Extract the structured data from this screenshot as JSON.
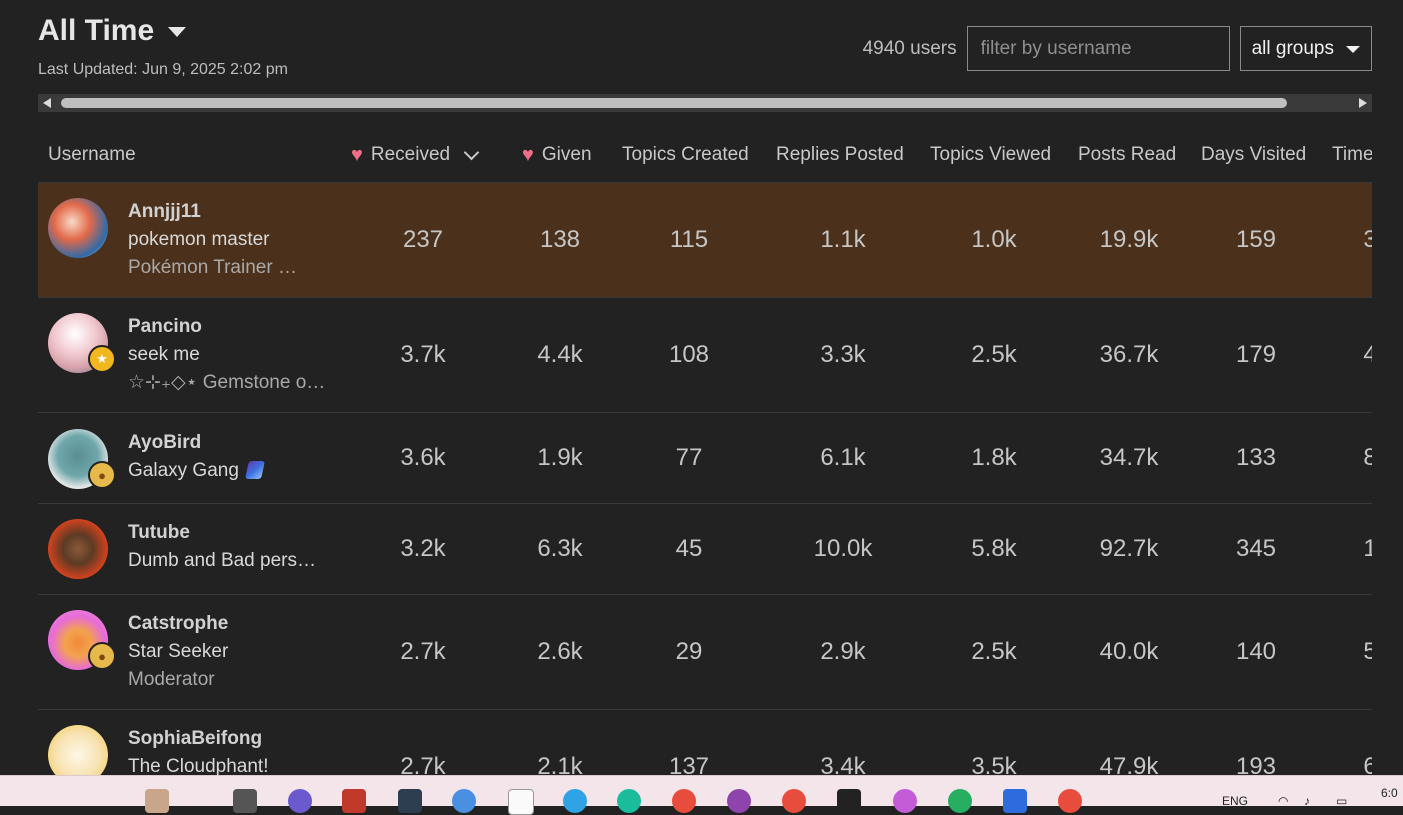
{
  "header": {
    "period": "All Time",
    "last_updated": "Last Updated: Jun 9, 2025 2:02 pm"
  },
  "controls": {
    "user_count": "4940 users",
    "filter_placeholder": "filter by username",
    "groups_selected": "all groups"
  },
  "columns": {
    "username": "Username",
    "received": "Received",
    "given": "Given",
    "topics_created": "Topics Created",
    "replies_posted": "Replies Posted",
    "topics_viewed": "Topics Viewed",
    "posts_read": "Posts Read",
    "days_visited": "Days Visited",
    "time": "Time"
  },
  "rows": [
    {
      "username": "Annjjj11",
      "title": "pokemon master",
      "group": "Pokémon Trainer …",
      "received": "237",
      "given": "138",
      "topics_created": "115",
      "replies_posted": "1.1k",
      "topics_viewed": "1.0k",
      "posts_read": "19.9k",
      "days_visited": "159",
      "time": "3"
    },
    {
      "username": "Pancino",
      "title": "seek me",
      "group": "☆⊹₊◇⋆ Gemstone o…",
      "received": "3.7k",
      "given": "4.4k",
      "topics_created": "108",
      "replies_posted": "3.3k",
      "topics_viewed": "2.5k",
      "posts_read": "36.7k",
      "days_visited": "179",
      "time": "4"
    },
    {
      "username": "AyoBird",
      "title": "Galaxy Gang",
      "received": "3.6k",
      "given": "1.9k",
      "topics_created": "77",
      "replies_posted": "6.1k",
      "topics_viewed": "1.8k",
      "posts_read": "34.7k",
      "days_visited": "133",
      "time": "8"
    },
    {
      "username": "Tutube",
      "title": "Dumb and Bad pers…",
      "received": "3.2k",
      "given": "6.3k",
      "topics_created": "45",
      "replies_posted": "10.0k",
      "topics_viewed": "5.8k",
      "posts_read": "92.7k",
      "days_visited": "345",
      "time": "1"
    },
    {
      "username": "Catstrophe",
      "title": "Star Seeker",
      "group": "Moderator",
      "received": "2.7k",
      "given": "2.6k",
      "topics_created": "29",
      "replies_posted": "2.9k",
      "topics_viewed": "2.5k",
      "posts_read": "40.0k",
      "days_visited": "140",
      "time": "5"
    },
    {
      "username": "SophiaBeifong",
      "title": "The Cloudphant!",
      "received": "2.7k",
      "given": "2.1k",
      "topics_created": "137",
      "replies_posted": "3.4k",
      "topics_viewed": "3.5k",
      "posts_read": "47.9k",
      "days_visited": "193",
      "time": "6"
    }
  ],
  "taskbar": {
    "lang": "ENG",
    "clock": "6:0"
  }
}
